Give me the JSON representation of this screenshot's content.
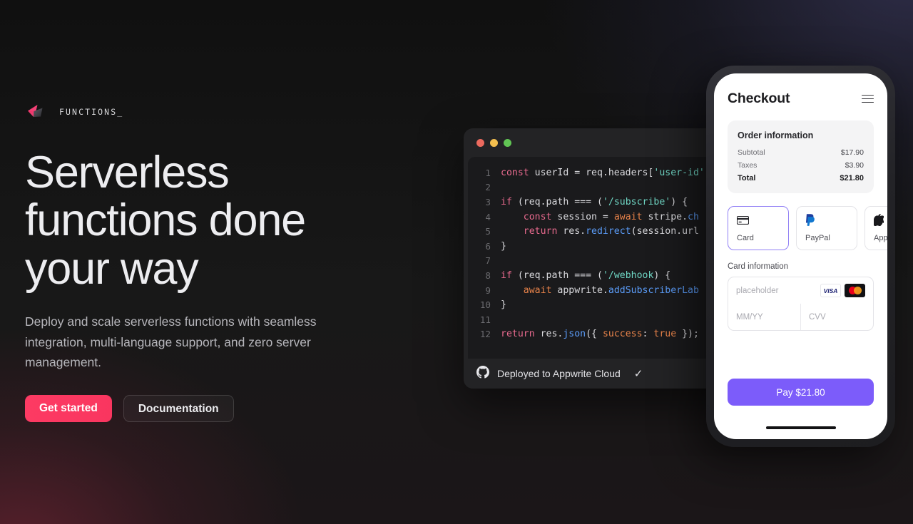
{
  "brand": {
    "label": "FUNCTIONS_",
    "logo_icon": "appwrite-functions-logo-icon",
    "accent": "#fd3a63"
  },
  "hero": {
    "headline": "Serverless functions done your way",
    "subhead": "Deploy and scale serverless functions with seamless integration, multi-language support, and zero server management.",
    "primary_cta": "Get started",
    "secondary_cta": "Documentation"
  },
  "code_window": {
    "traffic_lights": [
      "close",
      "minimize",
      "maximize"
    ],
    "lines": [
      {
        "n": "1",
        "tokens": [
          {
            "t": "const ",
            "c": "kw"
          },
          {
            "t": "userId = req.headers[",
            "c": "pl"
          },
          {
            "t": "'user-id'",
            "c": "str"
          },
          {
            "t": "]",
            "c": "pl"
          }
        ]
      },
      {
        "n": "2",
        "tokens": []
      },
      {
        "n": "3",
        "tokens": [
          {
            "t": "if ",
            "c": "kw"
          },
          {
            "t": "(req.path ",
            "c": "pl"
          },
          {
            "t": "===",
            "c": "pl"
          },
          {
            "t": " (",
            "c": "pl"
          },
          {
            "t": "'/subscribe'",
            "c": "str"
          },
          {
            "t": ") {",
            "c": "pl"
          }
        ]
      },
      {
        "n": "4",
        "tokens": [
          {
            "t": "    ",
            "c": "pl"
          },
          {
            "t": "const ",
            "c": "kw"
          },
          {
            "t": "session = ",
            "c": "pl"
          },
          {
            "t": "await ",
            "c": "or"
          },
          {
            "t": "stripe.",
            "c": "pl"
          },
          {
            "t": "ch",
            "c": "fn"
          }
        ]
      },
      {
        "n": "5",
        "tokens": [
          {
            "t": "    ",
            "c": "pl"
          },
          {
            "t": "return ",
            "c": "kw"
          },
          {
            "t": "res.",
            "c": "pl"
          },
          {
            "t": "redirect",
            "c": "fn"
          },
          {
            "t": "(session.url",
            "c": "pl"
          }
        ]
      },
      {
        "n": "6",
        "tokens": [
          {
            "t": "}",
            "c": "pl"
          }
        ]
      },
      {
        "n": "7",
        "tokens": []
      },
      {
        "n": "8",
        "tokens": [
          {
            "t": "if ",
            "c": "kw"
          },
          {
            "t": "(req.path ",
            "c": "pl"
          },
          {
            "t": "===",
            "c": "pl"
          },
          {
            "t": " (",
            "c": "pl"
          },
          {
            "t": "'/webhook",
            "c": "str"
          },
          {
            "t": ") {",
            "c": "pl"
          }
        ]
      },
      {
        "n": "9",
        "tokens": [
          {
            "t": "    ",
            "c": "pl"
          },
          {
            "t": "await ",
            "c": "or"
          },
          {
            "t": "appwrite.",
            "c": "pl"
          },
          {
            "t": "addSubscriberLab",
            "c": "fn"
          }
        ]
      },
      {
        "n": "10",
        "tokens": [
          {
            "t": "}",
            "c": "pl"
          }
        ]
      },
      {
        "n": "11",
        "tokens": []
      },
      {
        "n": "12",
        "tokens": [
          {
            "t": "return ",
            "c": "kw"
          },
          {
            "t": "res.",
            "c": "pl"
          },
          {
            "t": "json",
            "c": "fn"
          },
          {
            "t": "({ ",
            "c": "pl"
          },
          {
            "t": "success",
            "c": "or"
          },
          {
            "t": ": ",
            "c": "pl"
          },
          {
            "t": "true",
            "c": "or"
          },
          {
            "t": " });",
            "c": "pl"
          }
        ]
      }
    ],
    "footer": {
      "icon": "github-icon",
      "text": "Deployed to Appwrite Cloud",
      "status_icon": "check-icon"
    }
  },
  "phone": {
    "title": "Checkout",
    "menu_icon": "hamburger-menu-icon",
    "order": {
      "title": "Order information",
      "rows": [
        {
          "label": "Subtotal",
          "value": "$17.90"
        },
        {
          "label": "Taxes",
          "value": "$3.90"
        }
      ],
      "total_label": "Total",
      "total_value": "$21.80"
    },
    "payment_tabs": [
      {
        "label": "Card",
        "icon": "credit-card-icon",
        "active": true
      },
      {
        "label": "PayPal",
        "icon": "paypal-icon",
        "active": false
      },
      {
        "label": "Apple",
        "icon": "apple-icon",
        "active": false
      }
    ],
    "card_section_label": "Card information",
    "card_number_placeholder": "placeholder",
    "expiry_placeholder": "MM/YY",
    "cvv_placeholder": "CVV",
    "card_brands": [
      "VISA",
      "mastercard"
    ],
    "pay_button": "Pay $21.80",
    "pay_button_color": "#7c5cfa"
  }
}
